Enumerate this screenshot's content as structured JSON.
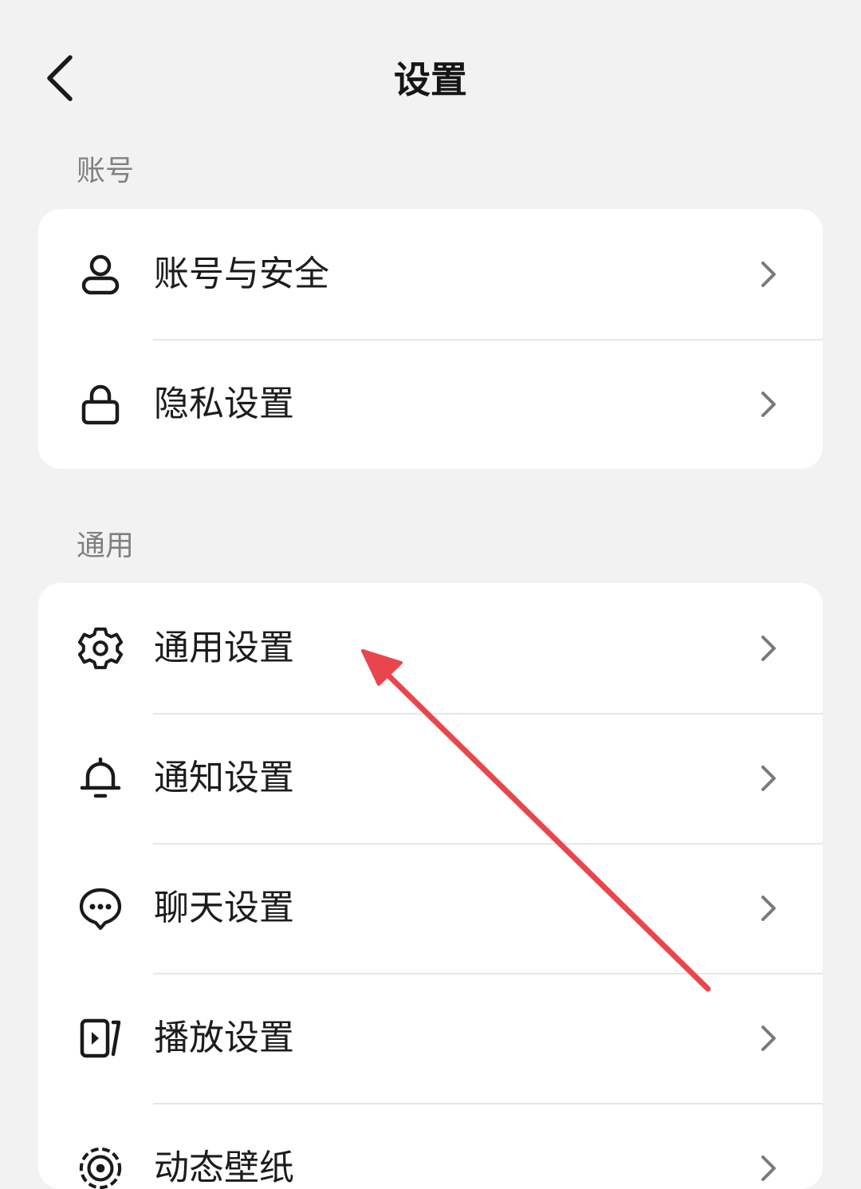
{
  "header": {
    "title": "设置",
    "back_icon": "chevron-left-icon"
  },
  "sections": [
    {
      "label": "账号",
      "items": [
        {
          "label": "账号与安全",
          "icon": "user-icon"
        },
        {
          "label": "隐私设置",
          "icon": "lock-icon"
        }
      ]
    },
    {
      "label": "通用",
      "items": [
        {
          "label": "通用设置",
          "icon": "gear-icon"
        },
        {
          "label": "通知设置",
          "icon": "bell-icon"
        },
        {
          "label": "聊天设置",
          "icon": "chat-bubble-icon"
        },
        {
          "label": "播放设置",
          "icon": "play-screen-icon"
        },
        {
          "label": "动态壁纸",
          "icon": "live-wallpaper-icon"
        }
      ]
    }
  ],
  "colors": {
    "background": "#f2f2f2",
    "card": "#ffffff",
    "text": "#1c1c1c",
    "section_label": "#808080",
    "divider": "#e6e6e6",
    "chevron": "#7a7a7a",
    "annotation_arrow": "#e8464c"
  }
}
